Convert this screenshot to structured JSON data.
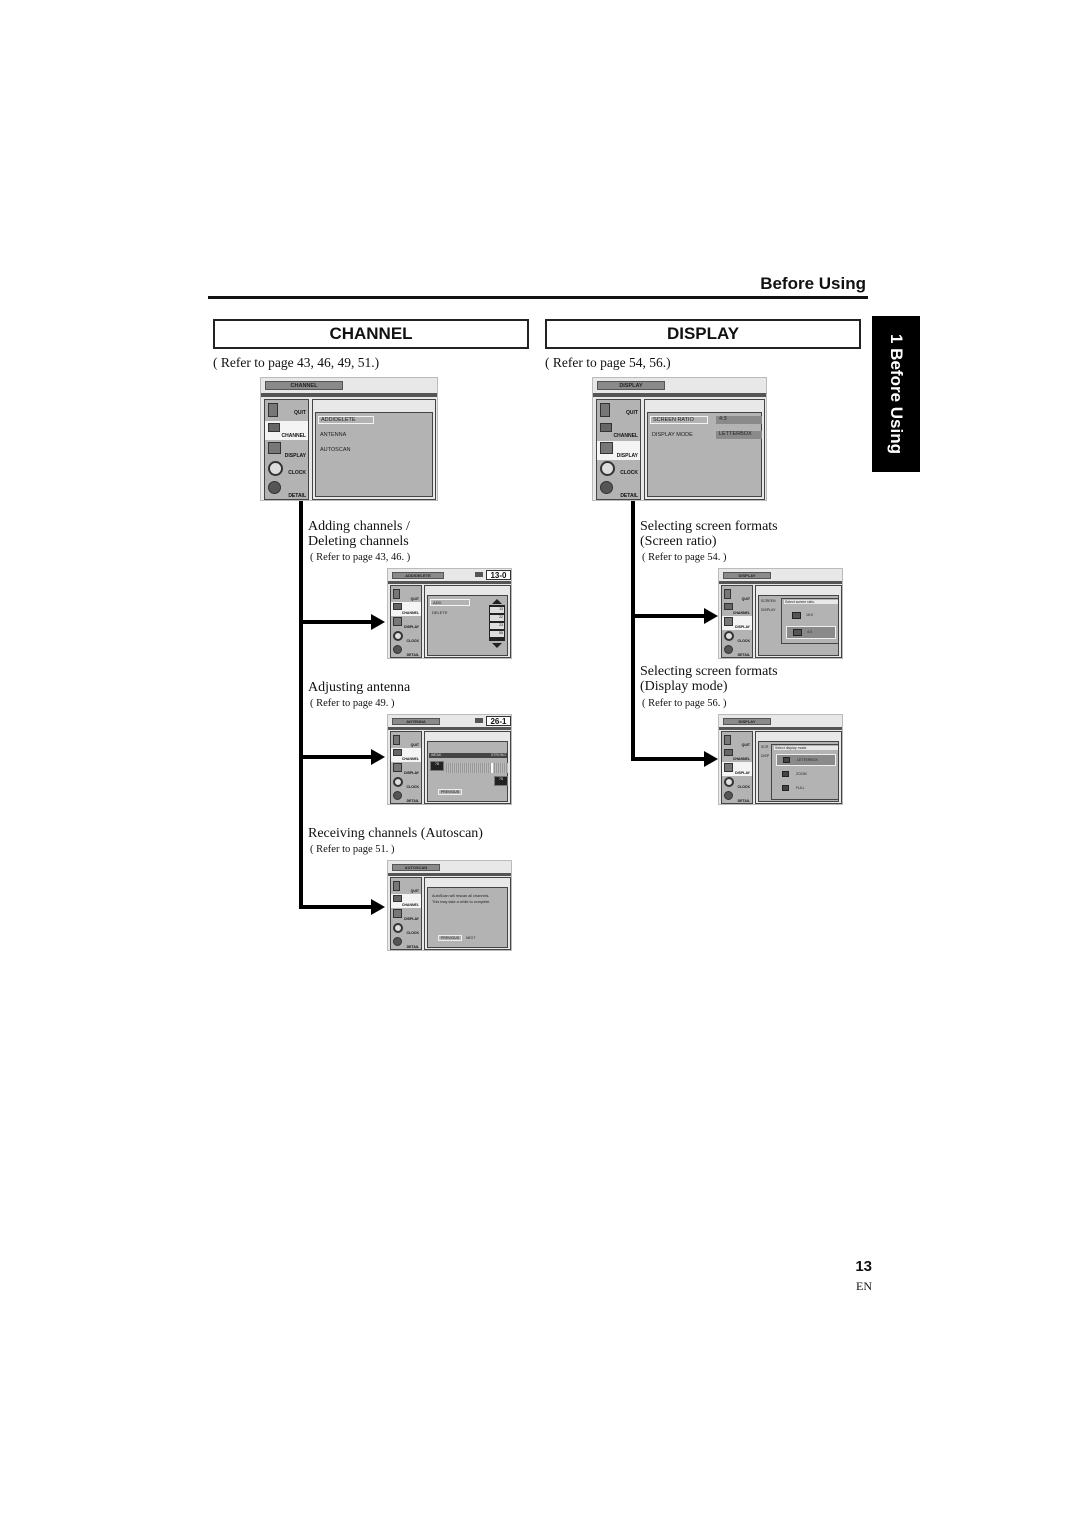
{
  "header": {
    "title": "Before Using"
  },
  "side_tab": {
    "label": "1 Before Using"
  },
  "channel": {
    "heading": "CHANNEL",
    "refer": "( Refer to page 43, 46, 49, 51.)",
    "menu": {
      "tab": "CHANNEL",
      "sidebar": [
        "QUIT",
        "CHANNEL",
        "DISPLAY",
        "CLOCK",
        "DETAIL"
      ],
      "items": [
        "ADD/DELETE",
        "ANTENNA",
        "AUTOSCAN"
      ]
    },
    "subsections": [
      {
        "title_lines": [
          "Adding channels /",
          "Deleting channels"
        ],
        "refer": "( Refer to page 43, 46. )",
        "screen": {
          "tab": "ADD/DELETE",
          "channel_number": "13-0",
          "items": [
            "ADD",
            "DELETE"
          ],
          "channel_list": [
            "13",
            "22",
            "23",
            "55"
          ]
        }
      },
      {
        "title_lines": [
          "Adjusting antenna"
        ],
        "refer": "( Refer to page 49. )",
        "screen": {
          "tab": "ANTENNA",
          "channel_number": "26-1",
          "weak_label": "WEAK",
          "strong_label": "STRONG",
          "now_value": "78",
          "max_value": "75",
          "previous_label": "PREVIOUS"
        }
      },
      {
        "title_lines": [
          "Receiving channels (Autoscan)"
        ],
        "refer": "( Refer to page 51. )",
        "screen": {
          "tab": "AUTOSCAN",
          "message_lines": [
            "AutoScan will rescan all channels.",
            "This may take a while to complete."
          ],
          "previous_label": "PREVIOUS",
          "next_label": "NEXT"
        }
      }
    ]
  },
  "display": {
    "heading": "DISPLAY",
    "refer": "( Refer to page 54, 56.)",
    "menu": {
      "tab": "DISPLAY",
      "sidebar": [
        "QUIT",
        "CHANNEL",
        "DISPLAY",
        "CLOCK",
        "DETAIL"
      ],
      "rows": [
        {
          "label": "SCREEN RATIO",
          "value": "4:3"
        },
        {
          "label": "DISPLAY MODE",
          "value": "LETTERBOX"
        }
      ]
    },
    "subsections": [
      {
        "title_lines": [
          "Selecting screen formats",
          "(Screen ratio)"
        ],
        "refer": "( Refer to page 54. )",
        "screen": {
          "tab": "DISPLAY",
          "bg_labels": [
            "SCREEN",
            "DISPLAY"
          ],
          "popup_title": "Select screen ratio.",
          "options": [
            "16:9",
            "4:3"
          ],
          "selected": "4:3"
        }
      },
      {
        "title_lines": [
          "Selecting screen formats",
          "(Display mode)"
        ],
        "refer": "( Refer to page 56. )",
        "screen": {
          "tab": "DISPLAY",
          "bg_labels": [
            "SCR",
            "DISP"
          ],
          "popup_title": "Select display mode.",
          "options": [
            "LETTERBOX",
            "ZOOM",
            "FULL"
          ],
          "selected": "LETTERBOX"
        }
      }
    ]
  },
  "footer": {
    "page_number": "13",
    "language": "EN"
  }
}
